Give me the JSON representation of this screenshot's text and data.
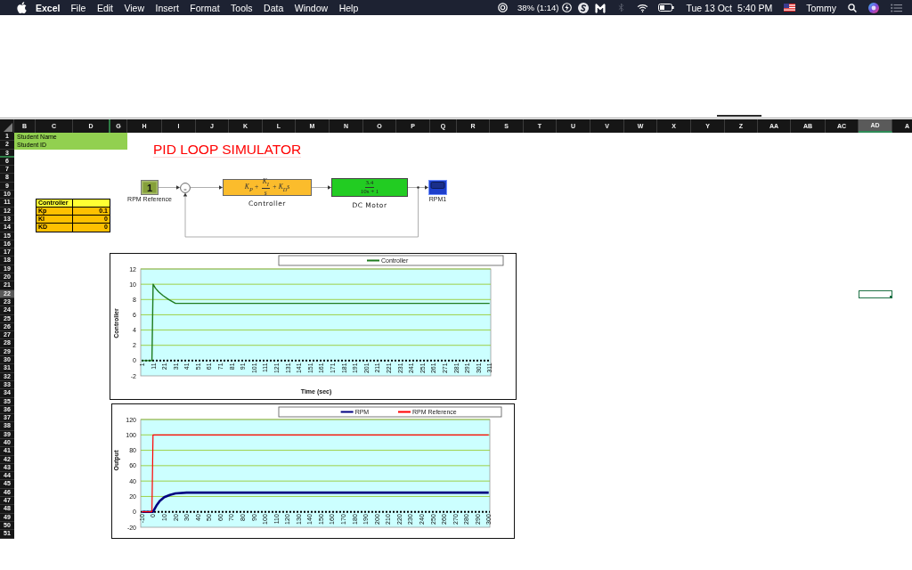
{
  "menu_bar": {
    "app": "Excel",
    "menus": [
      "File",
      "Edit",
      "View",
      "Insert",
      "Format",
      "Tools",
      "Data",
      "Window",
      "Help"
    ],
    "battery_text": "38% (1:14)",
    "date": "Tue 13 Oct",
    "time": "5:40 PM",
    "user": "Tommy"
  },
  "sheet": {
    "columns": [
      {
        "label": "B",
        "selected": false
      },
      {
        "label": "C",
        "selected": false
      },
      {
        "label": "D",
        "selected": false
      },
      {
        "label": "G",
        "selected": false
      },
      {
        "label": "H",
        "selected": false
      },
      {
        "label": "I",
        "selected": false
      },
      {
        "label": "J",
        "selected": false
      },
      {
        "label": "K",
        "selected": false
      },
      {
        "label": "L",
        "selected": false
      },
      {
        "label": "M",
        "selected": false
      },
      {
        "label": "N",
        "selected": false
      },
      {
        "label": "O",
        "selected": false
      },
      {
        "label": "P",
        "selected": false
      },
      {
        "label": "Q",
        "selected": false
      },
      {
        "label": "R",
        "selected": false
      },
      {
        "label": "S",
        "selected": false
      },
      {
        "label": "T",
        "selected": false
      },
      {
        "label": "U",
        "selected": false
      },
      {
        "label": "V",
        "selected": false
      },
      {
        "label": "W",
        "selected": false
      },
      {
        "label": "X",
        "selected": false
      },
      {
        "label": "Y",
        "selected": false
      },
      {
        "label": "Z",
        "selected": false
      },
      {
        "label": "AA",
        "selected": false
      },
      {
        "label": "AB",
        "selected": false
      },
      {
        "label": "AC",
        "selected": false
      },
      {
        "label": "AD",
        "selected": true
      },
      {
        "label": "A",
        "selected": false
      }
    ],
    "rows": [
      {
        "label": "1",
        "selected": false
      },
      {
        "label": "2",
        "selected": false
      },
      {
        "label": "3",
        "selected": false
      },
      {
        "label": "6",
        "selected": false
      },
      {
        "label": "7",
        "selected": false
      },
      {
        "label": "8",
        "selected": false
      },
      {
        "label": "9",
        "selected": false
      },
      {
        "label": "10",
        "selected": false
      },
      {
        "label": "11",
        "selected": false
      },
      {
        "label": "12",
        "selected": false
      },
      {
        "label": "13",
        "selected": false
      },
      {
        "label": "14",
        "selected": false
      },
      {
        "label": "15",
        "selected": false
      },
      {
        "label": "16",
        "selected": false
      },
      {
        "label": "17",
        "selected": false
      },
      {
        "label": "18",
        "selected": false
      },
      {
        "label": "19",
        "selected": false
      },
      {
        "label": "20",
        "selected": false
      },
      {
        "label": "21",
        "selected": false
      },
      {
        "label": "22",
        "selected": true
      },
      {
        "label": "23",
        "selected": false
      },
      {
        "label": "24",
        "selected": false
      },
      {
        "label": "25",
        "selected": false
      },
      {
        "label": "26",
        "selected": false
      },
      {
        "label": "27",
        "selected": false
      },
      {
        "label": "28",
        "selected": false
      },
      {
        "label": "29",
        "selected": false
      },
      {
        "label": "30",
        "selected": false
      },
      {
        "label": "31",
        "selected": false
      },
      {
        "label": "32",
        "selected": false
      },
      {
        "label": "33",
        "selected": false
      },
      {
        "label": "34",
        "selected": false
      },
      {
        "label": "35",
        "selected": false
      },
      {
        "label": "36",
        "selected": false
      },
      {
        "label": "37",
        "selected": false
      },
      {
        "label": "38",
        "selected": false
      },
      {
        "label": "39",
        "selected": false
      },
      {
        "label": "40",
        "selected": false
      },
      {
        "label": "41",
        "selected": false
      },
      {
        "label": "42",
        "selected": false
      },
      {
        "label": "43",
        "selected": false
      },
      {
        "label": "44",
        "selected": false
      },
      {
        "label": "45",
        "selected": false
      },
      {
        "label": "46",
        "selected": false
      },
      {
        "label": "47",
        "selected": false
      },
      {
        "label": "48",
        "selected": false
      },
      {
        "label": "49",
        "selected": false
      },
      {
        "label": "50",
        "selected": false
      },
      {
        "label": "51",
        "selected": false
      }
    ],
    "cells": [
      {
        "text": "Student Name"
      },
      {
        "text": "Student ID"
      }
    ]
  },
  "title": "PID LOOP SIMULATOR",
  "diagram": {
    "blocks": [
      {
        "kind": "constant",
        "value": "1",
        "label": "RPM Reference"
      },
      {
        "kind": "sum"
      },
      {
        "kind": "controller",
        "formula": [
          {
            "kind": "text",
            "text": "K$_{P}$ +"
          },
          {
            "kind": "fraction",
            "numerator": "K$_{I}$",
            "denominator": "s"
          },
          {
            "kind": "text",
            "text": "+ K$_{D}$s"
          }
        ],
        "label": "Controller"
      },
      {
        "kind": "transfer",
        "numerator": "3.4",
        "denominator": "10s + 1",
        "label": "DC Motor"
      },
      {
        "kind": "scope",
        "label": "RPM1"
      }
    ]
  },
  "controller_table": {
    "title": "Controller",
    "rows": [
      {
        "name": "Kp",
        "value": "0.1"
      },
      {
        "name": "KI",
        "value": "0"
      },
      {
        "name": "KD",
        "value": "0"
      }
    ]
  },
  "charts": [
    {
      "chart_data": {
        "type": "line",
        "ylabel": "Controller",
        "xlabel": "Time (sec)",
        "xlim": [
          0,
          312
        ],
        "ylim": [
          -2,
          12
        ],
        "xticks": [
          1,
          11,
          21,
          31,
          41,
          51,
          61,
          71,
          81,
          91,
          101,
          111,
          121,
          131,
          141,
          151,
          161,
          171,
          181,
          191,
          201,
          211,
          221,
          231,
          241,
          251,
          261,
          271,
          281,
          291,
          301,
          311
        ],
        "yticks": [
          -2,
          0,
          2,
          4,
          6,
          8,
          10,
          12
        ],
        "grid": true,
        "legend": "top",
        "series": [
          {
            "name": "Controller",
            "color": "#1e7b1e",
            "x": [
              1,
              10,
              11,
              13,
              16,
              20,
              25,
              31,
              41,
              311
            ],
            "values": [
              0,
              0,
              10,
              9.5,
              9,
              8.5,
              8,
              7.5,
              7.5,
              7.5
            ]
          }
        ]
      }
    },
    {
      "chart_data": {
        "type": "line",
        "ylabel": "Output",
        "xlim": [
          -11,
          301
        ],
        "ylim": [
          -20,
          120
        ],
        "xticks": [
          -10,
          0,
          10,
          20,
          30,
          40,
          50,
          60,
          70,
          80,
          90,
          100,
          110,
          120,
          130,
          140,
          150,
          160,
          170,
          180,
          190,
          200,
          210,
          220,
          230,
          240,
          250,
          260,
          270,
          280,
          290,
          300
        ],
        "yticks": [
          -20,
          0,
          20,
          40,
          60,
          80,
          100,
          120
        ],
        "grid": true,
        "legend": "top",
        "series": [
          {
            "name": "RPM",
            "color": "#000080",
            "x": [
              -10,
              0,
              3,
              6,
              10,
              15,
              20,
              30,
              40,
              50,
              300
            ],
            "values": [
              0,
              0,
              8,
              14,
              19,
              22,
              24,
              25,
              25,
              25,
              25
            ]
          },
          {
            "name": "RPM Reference",
            "color": "#ff0000",
            "x": [
              -10,
              -1,
              0,
              300
            ],
            "values": [
              0,
              0,
              100,
              100
            ]
          }
        ]
      }
    }
  ]
}
